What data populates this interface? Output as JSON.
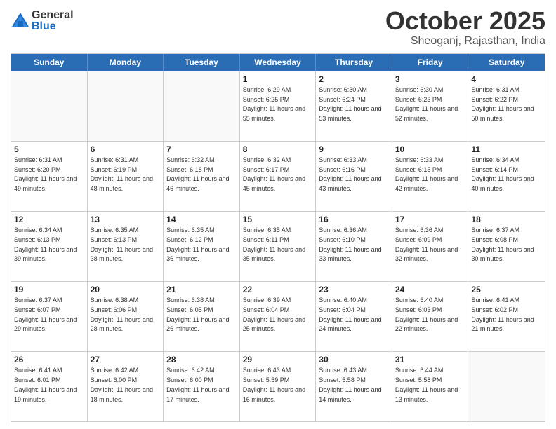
{
  "header": {
    "logo_general": "General",
    "logo_blue": "Blue",
    "month_title": "October 2025",
    "subtitle": "Sheoganj, Rajasthan, India"
  },
  "days_of_week": [
    "Sunday",
    "Monday",
    "Tuesday",
    "Wednesday",
    "Thursday",
    "Friday",
    "Saturday"
  ],
  "weeks": [
    [
      {
        "day": "",
        "info": ""
      },
      {
        "day": "",
        "info": ""
      },
      {
        "day": "",
        "info": ""
      },
      {
        "day": "1",
        "info": "Sunrise: 6:29 AM\nSunset: 6:25 PM\nDaylight: 11 hours and 55 minutes."
      },
      {
        "day": "2",
        "info": "Sunrise: 6:30 AM\nSunset: 6:24 PM\nDaylight: 11 hours and 53 minutes."
      },
      {
        "day": "3",
        "info": "Sunrise: 6:30 AM\nSunset: 6:23 PM\nDaylight: 11 hours and 52 minutes."
      },
      {
        "day": "4",
        "info": "Sunrise: 6:31 AM\nSunset: 6:22 PM\nDaylight: 11 hours and 50 minutes."
      }
    ],
    [
      {
        "day": "5",
        "info": "Sunrise: 6:31 AM\nSunset: 6:20 PM\nDaylight: 11 hours and 49 minutes."
      },
      {
        "day": "6",
        "info": "Sunrise: 6:31 AM\nSunset: 6:19 PM\nDaylight: 11 hours and 48 minutes."
      },
      {
        "day": "7",
        "info": "Sunrise: 6:32 AM\nSunset: 6:18 PM\nDaylight: 11 hours and 46 minutes."
      },
      {
        "day": "8",
        "info": "Sunrise: 6:32 AM\nSunset: 6:17 PM\nDaylight: 11 hours and 45 minutes."
      },
      {
        "day": "9",
        "info": "Sunrise: 6:33 AM\nSunset: 6:16 PM\nDaylight: 11 hours and 43 minutes."
      },
      {
        "day": "10",
        "info": "Sunrise: 6:33 AM\nSunset: 6:15 PM\nDaylight: 11 hours and 42 minutes."
      },
      {
        "day": "11",
        "info": "Sunrise: 6:34 AM\nSunset: 6:14 PM\nDaylight: 11 hours and 40 minutes."
      }
    ],
    [
      {
        "day": "12",
        "info": "Sunrise: 6:34 AM\nSunset: 6:13 PM\nDaylight: 11 hours and 39 minutes."
      },
      {
        "day": "13",
        "info": "Sunrise: 6:35 AM\nSunset: 6:13 PM\nDaylight: 11 hours and 38 minutes."
      },
      {
        "day": "14",
        "info": "Sunrise: 6:35 AM\nSunset: 6:12 PM\nDaylight: 11 hours and 36 minutes."
      },
      {
        "day": "15",
        "info": "Sunrise: 6:35 AM\nSunset: 6:11 PM\nDaylight: 11 hours and 35 minutes."
      },
      {
        "day": "16",
        "info": "Sunrise: 6:36 AM\nSunset: 6:10 PM\nDaylight: 11 hours and 33 minutes."
      },
      {
        "day": "17",
        "info": "Sunrise: 6:36 AM\nSunset: 6:09 PM\nDaylight: 11 hours and 32 minutes."
      },
      {
        "day": "18",
        "info": "Sunrise: 6:37 AM\nSunset: 6:08 PM\nDaylight: 11 hours and 30 minutes."
      }
    ],
    [
      {
        "day": "19",
        "info": "Sunrise: 6:37 AM\nSunset: 6:07 PM\nDaylight: 11 hours and 29 minutes."
      },
      {
        "day": "20",
        "info": "Sunrise: 6:38 AM\nSunset: 6:06 PM\nDaylight: 11 hours and 28 minutes."
      },
      {
        "day": "21",
        "info": "Sunrise: 6:38 AM\nSunset: 6:05 PM\nDaylight: 11 hours and 26 minutes."
      },
      {
        "day": "22",
        "info": "Sunrise: 6:39 AM\nSunset: 6:04 PM\nDaylight: 11 hours and 25 minutes."
      },
      {
        "day": "23",
        "info": "Sunrise: 6:40 AM\nSunset: 6:04 PM\nDaylight: 11 hours and 24 minutes."
      },
      {
        "day": "24",
        "info": "Sunrise: 6:40 AM\nSunset: 6:03 PM\nDaylight: 11 hours and 22 minutes."
      },
      {
        "day": "25",
        "info": "Sunrise: 6:41 AM\nSunset: 6:02 PM\nDaylight: 11 hours and 21 minutes."
      }
    ],
    [
      {
        "day": "26",
        "info": "Sunrise: 6:41 AM\nSunset: 6:01 PM\nDaylight: 11 hours and 19 minutes."
      },
      {
        "day": "27",
        "info": "Sunrise: 6:42 AM\nSunset: 6:00 PM\nDaylight: 11 hours and 18 minutes."
      },
      {
        "day": "28",
        "info": "Sunrise: 6:42 AM\nSunset: 6:00 PM\nDaylight: 11 hours and 17 minutes."
      },
      {
        "day": "29",
        "info": "Sunrise: 6:43 AM\nSunset: 5:59 PM\nDaylight: 11 hours and 16 minutes."
      },
      {
        "day": "30",
        "info": "Sunrise: 6:43 AM\nSunset: 5:58 PM\nDaylight: 11 hours and 14 minutes."
      },
      {
        "day": "31",
        "info": "Sunrise: 6:44 AM\nSunset: 5:58 PM\nDaylight: 11 hours and 13 minutes."
      },
      {
        "day": "",
        "info": ""
      }
    ]
  ]
}
